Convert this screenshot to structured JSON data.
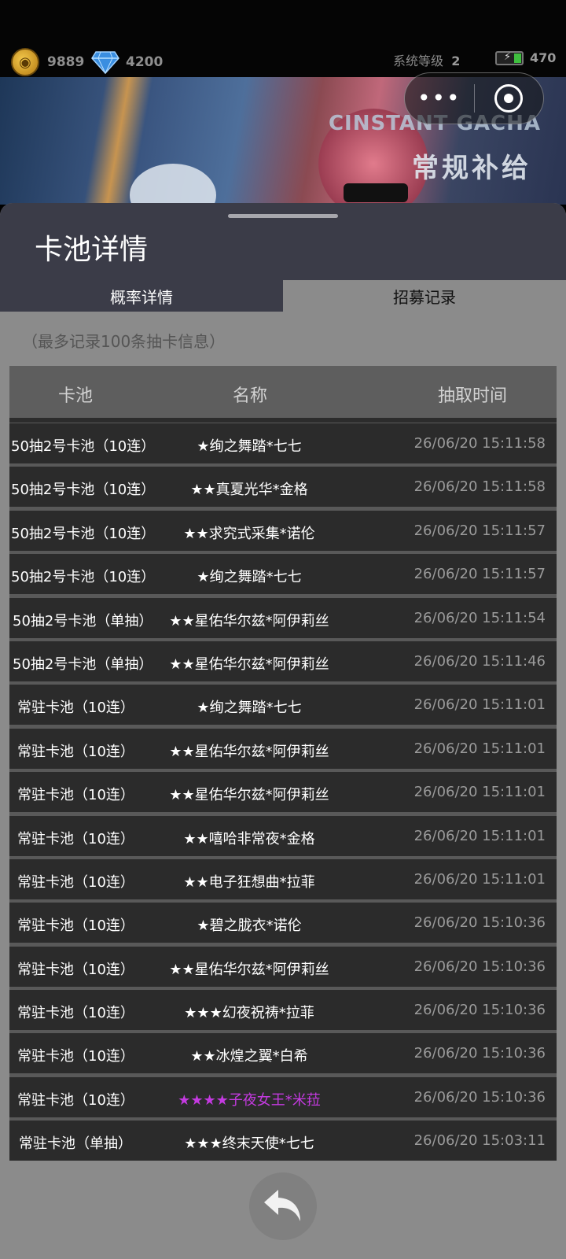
{
  "status": {
    "coins": "9889",
    "gems": "4200",
    "level_label": "系统等级",
    "level_value": "2",
    "energy": "470"
  },
  "banner": {
    "title_en": "CINSTANT GACHA",
    "title_cn": "常规补给"
  },
  "sheet": {
    "title": "卡池详情",
    "tabs": [
      {
        "label": "概率详情",
        "active": false
      },
      {
        "label": "招募记录",
        "active": true
      }
    ],
    "note": "（最多记录100条抽卡信息）"
  },
  "table": {
    "headers": {
      "pool": "卡池",
      "name": "名称",
      "time": "抽取时间"
    },
    "rows": [
      {
        "pool": "50抽2号卡池（10连）",
        "name": "★绚之舞踏*七七",
        "time": "26/06/20 15:11:58"
      },
      {
        "pool": "50抽2号卡池（10连）",
        "name": "★★真夏光华*金格",
        "time": "26/06/20 15:11:58"
      },
      {
        "pool": "50抽2号卡池（10连）",
        "name": "★★求究式采集*诺伦",
        "time": "26/06/20 15:11:57"
      },
      {
        "pool": "50抽2号卡池（10连）",
        "name": "★绚之舞踏*七七",
        "time": "26/06/20 15:11:57"
      },
      {
        "pool": "50抽2号卡池（单抽）",
        "name": "★★星佑华尔兹*阿伊莉丝",
        "time": "26/06/20 15:11:54"
      },
      {
        "pool": "50抽2号卡池（单抽）",
        "name": "★★星佑华尔兹*阿伊莉丝",
        "time": "26/06/20 15:11:46"
      },
      {
        "pool": "常驻卡池（10连）",
        "name": "★绚之舞踏*七七",
        "time": "26/06/20 15:11:01"
      },
      {
        "pool": "常驻卡池（10连）",
        "name": "★★星佑华尔兹*阿伊莉丝",
        "time": "26/06/20 15:11:01"
      },
      {
        "pool": "常驻卡池（10连）",
        "name": "★★星佑华尔兹*阿伊莉丝",
        "time": "26/06/20 15:11:01"
      },
      {
        "pool": "常驻卡池（10连）",
        "name": "★★嘻哈非常夜*金格",
        "time": "26/06/20 15:11:01"
      },
      {
        "pool": "常驻卡池（10连）",
        "name": "★★电子狂想曲*拉菲",
        "time": "26/06/20 15:11:01"
      },
      {
        "pool": "常驻卡池（10连）",
        "name": "★碧之胧衣*诺伦",
        "time": "26/06/20 15:10:36"
      },
      {
        "pool": "常驻卡池（10连）",
        "name": "★★星佑华尔兹*阿伊莉丝",
        "time": "26/06/20 15:10:36"
      },
      {
        "pool": "常驻卡池（10连）",
        "name": "★★★幻夜祝祷*拉菲",
        "time": "26/06/20 15:10:36"
      },
      {
        "pool": "常驻卡池（10连）",
        "name": "★★冰煌之翼*白希",
        "time": "26/06/20 15:10:36"
      },
      {
        "pool": "常驻卡池（10连）",
        "name": "★★★★子夜女王*米菈",
        "time": "26/06/20 15:10:36"
      },
      {
        "pool": "常驻卡池（单抽）",
        "name": "★★★终末天使*七七",
        "time": "26/06/20 15:03:11"
      }
    ]
  },
  "colors": {
    "rare_name": "#c43ae0",
    "sheet_header": "#3b3c48",
    "row_bg": "#2b2b2b"
  },
  "icons": {
    "coin": "coin-icon",
    "gem": "diamond-icon",
    "energy": "battery-icon",
    "menu": "more-dots-icon",
    "close": "target-close-icon",
    "back": "return-arrow-icon"
  }
}
